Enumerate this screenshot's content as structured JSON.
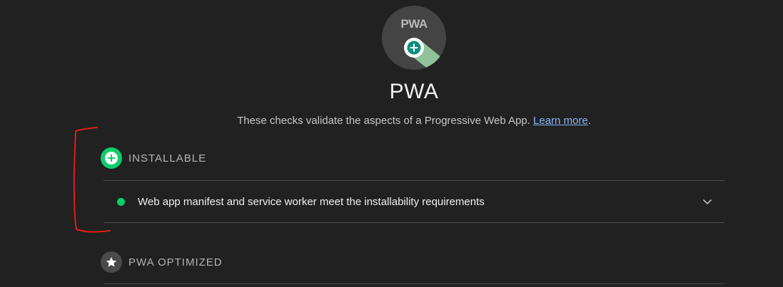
{
  "category": {
    "logo_text": "PWA",
    "title": "PWA",
    "description": "These checks validate the aspects of a Progressive Web App.",
    "learn_more": "Learn more",
    "after_link": "."
  },
  "groups": [
    {
      "title": "INSTALLABLE",
      "icon": "plus-icon",
      "color": "#0cce6b",
      "audits": [
        {
          "title": "Web app manifest and service worker meet the installability requirements",
          "status": "pass",
          "status_color": "#0cce6b"
        }
      ]
    },
    {
      "title": "PWA OPTIMIZED",
      "icon": "star-icon",
      "color": "#4a4a4a",
      "audits": []
    }
  ],
  "colors": {
    "background": "#212121",
    "pass": "#0cce6b",
    "link": "#8ab4f8",
    "annotation": "#e01e1e"
  }
}
